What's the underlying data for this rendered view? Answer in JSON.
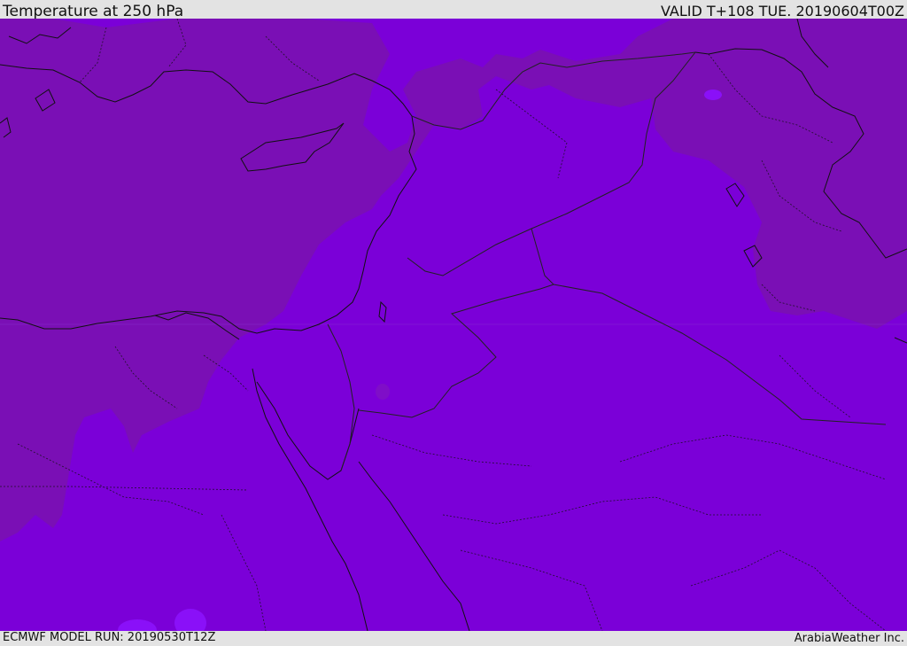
{
  "header": {
    "title": "Temperature at 250 hPa",
    "valid": "VALID T+108 TUE. 20190604T00Z"
  },
  "footer": {
    "model_run": "ECMWF MODEL RUN: 20190530T12Z",
    "credit": "ArabiaWeather Inc."
  },
  "map": {
    "colors": {
      "cold_band": "#7a0fb5",
      "main_band": "#7b00d8",
      "warm_spot": "#8a10f8",
      "coastline": "#111111",
      "border": "#222222"
    }
  }
}
